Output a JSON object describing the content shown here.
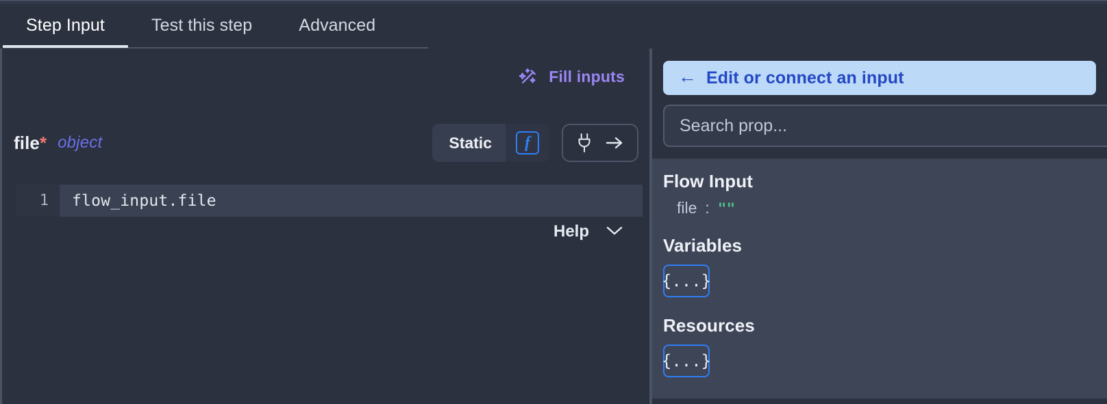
{
  "tabs": [
    {
      "label": "Step Input",
      "active": true
    },
    {
      "label": "Test this step",
      "active": false
    },
    {
      "label": "Advanced",
      "active": false
    }
  ],
  "left_pane": {
    "fill_inputs": {
      "label": "Fill inputs",
      "icon": "magic-wand-icon",
      "color": "#9b86f3"
    },
    "field": {
      "name": "file",
      "required_marker": "*",
      "type": "object",
      "mode_label": "Static",
      "fx_glyph": "f",
      "plug_icon": "plug-icon",
      "arrow_icon": "arrow-right-icon"
    },
    "editor": {
      "line_number": "1",
      "code": "flow_input.file"
    },
    "help": {
      "label": "Help",
      "chevron": "chevron-down-icon"
    }
  },
  "right_pane": {
    "connect_button": {
      "arrow": "←",
      "label": "Edit or connect an input",
      "bg": "#bcd9f8",
      "fg": "#2448c4"
    },
    "search": {
      "value": "",
      "placeholder": "Search prop..."
    },
    "sections": [
      {
        "heading": "Flow Input",
        "rows": [
          {
            "key": "file",
            "colon": ":",
            "value": "\"\""
          }
        ]
      },
      {
        "heading": "Variables",
        "badge": "{...}"
      },
      {
        "heading": "Resources",
        "badge": "{...}"
      }
    ]
  }
}
